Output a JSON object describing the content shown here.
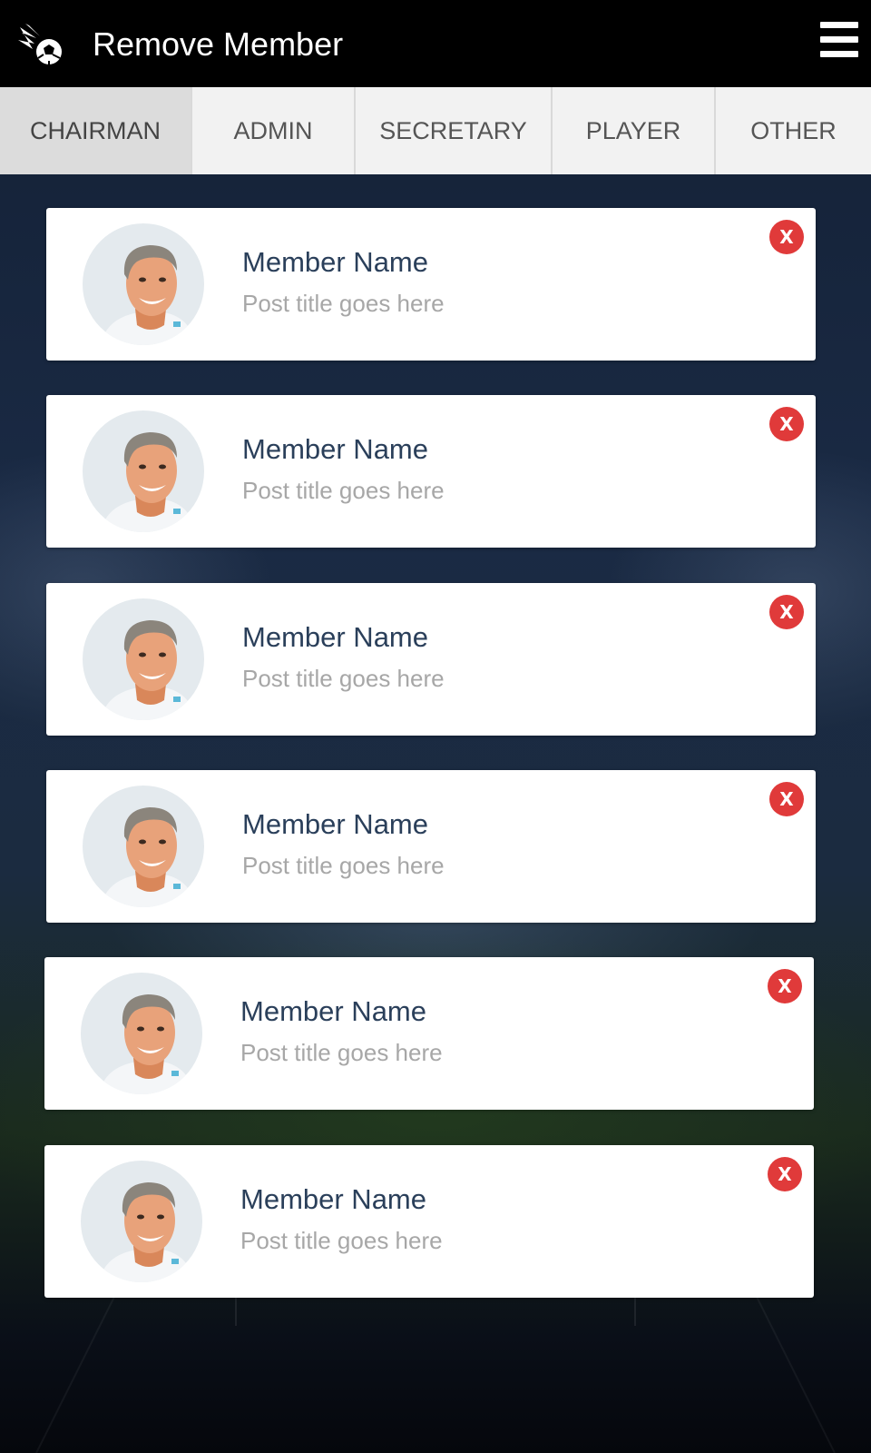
{
  "header": {
    "title": "Remove Member",
    "logo_icon": "flaming-soccer-ball-icon",
    "menu_icon": "hamburger-menu-icon"
  },
  "tabs": [
    {
      "label": "CHAIRMAN",
      "active": true
    },
    {
      "label": "ADMIN",
      "active": false
    },
    {
      "label": "SECRETARY",
      "active": false
    },
    {
      "label": "PLAYER",
      "active": false
    },
    {
      "label": "OTHER",
      "active": false
    }
  ],
  "members": [
    {
      "name": "Member Name",
      "post": "Post title goes here",
      "remove_label": "X"
    },
    {
      "name": "Member Name",
      "post": "Post title goes here",
      "remove_label": "X"
    },
    {
      "name": "Member Name",
      "post": "Post title goes here",
      "remove_label": "X"
    },
    {
      "name": "Member Name",
      "post": "Post title goes here",
      "remove_label": "X"
    },
    {
      "name": "Member Name",
      "post": "Post title goes here",
      "remove_label": "X"
    },
    {
      "name": "Member Name",
      "post": "Post title goes here",
      "remove_label": "X"
    }
  ],
  "colors": {
    "appbar": "#000000",
    "tab_bg": "#f2f2f2",
    "tab_active_bg": "#dcdcdc",
    "remove_button": "#e03a3a",
    "member_name": "#2a3f5a",
    "post_title": "#a7a7a7"
  }
}
